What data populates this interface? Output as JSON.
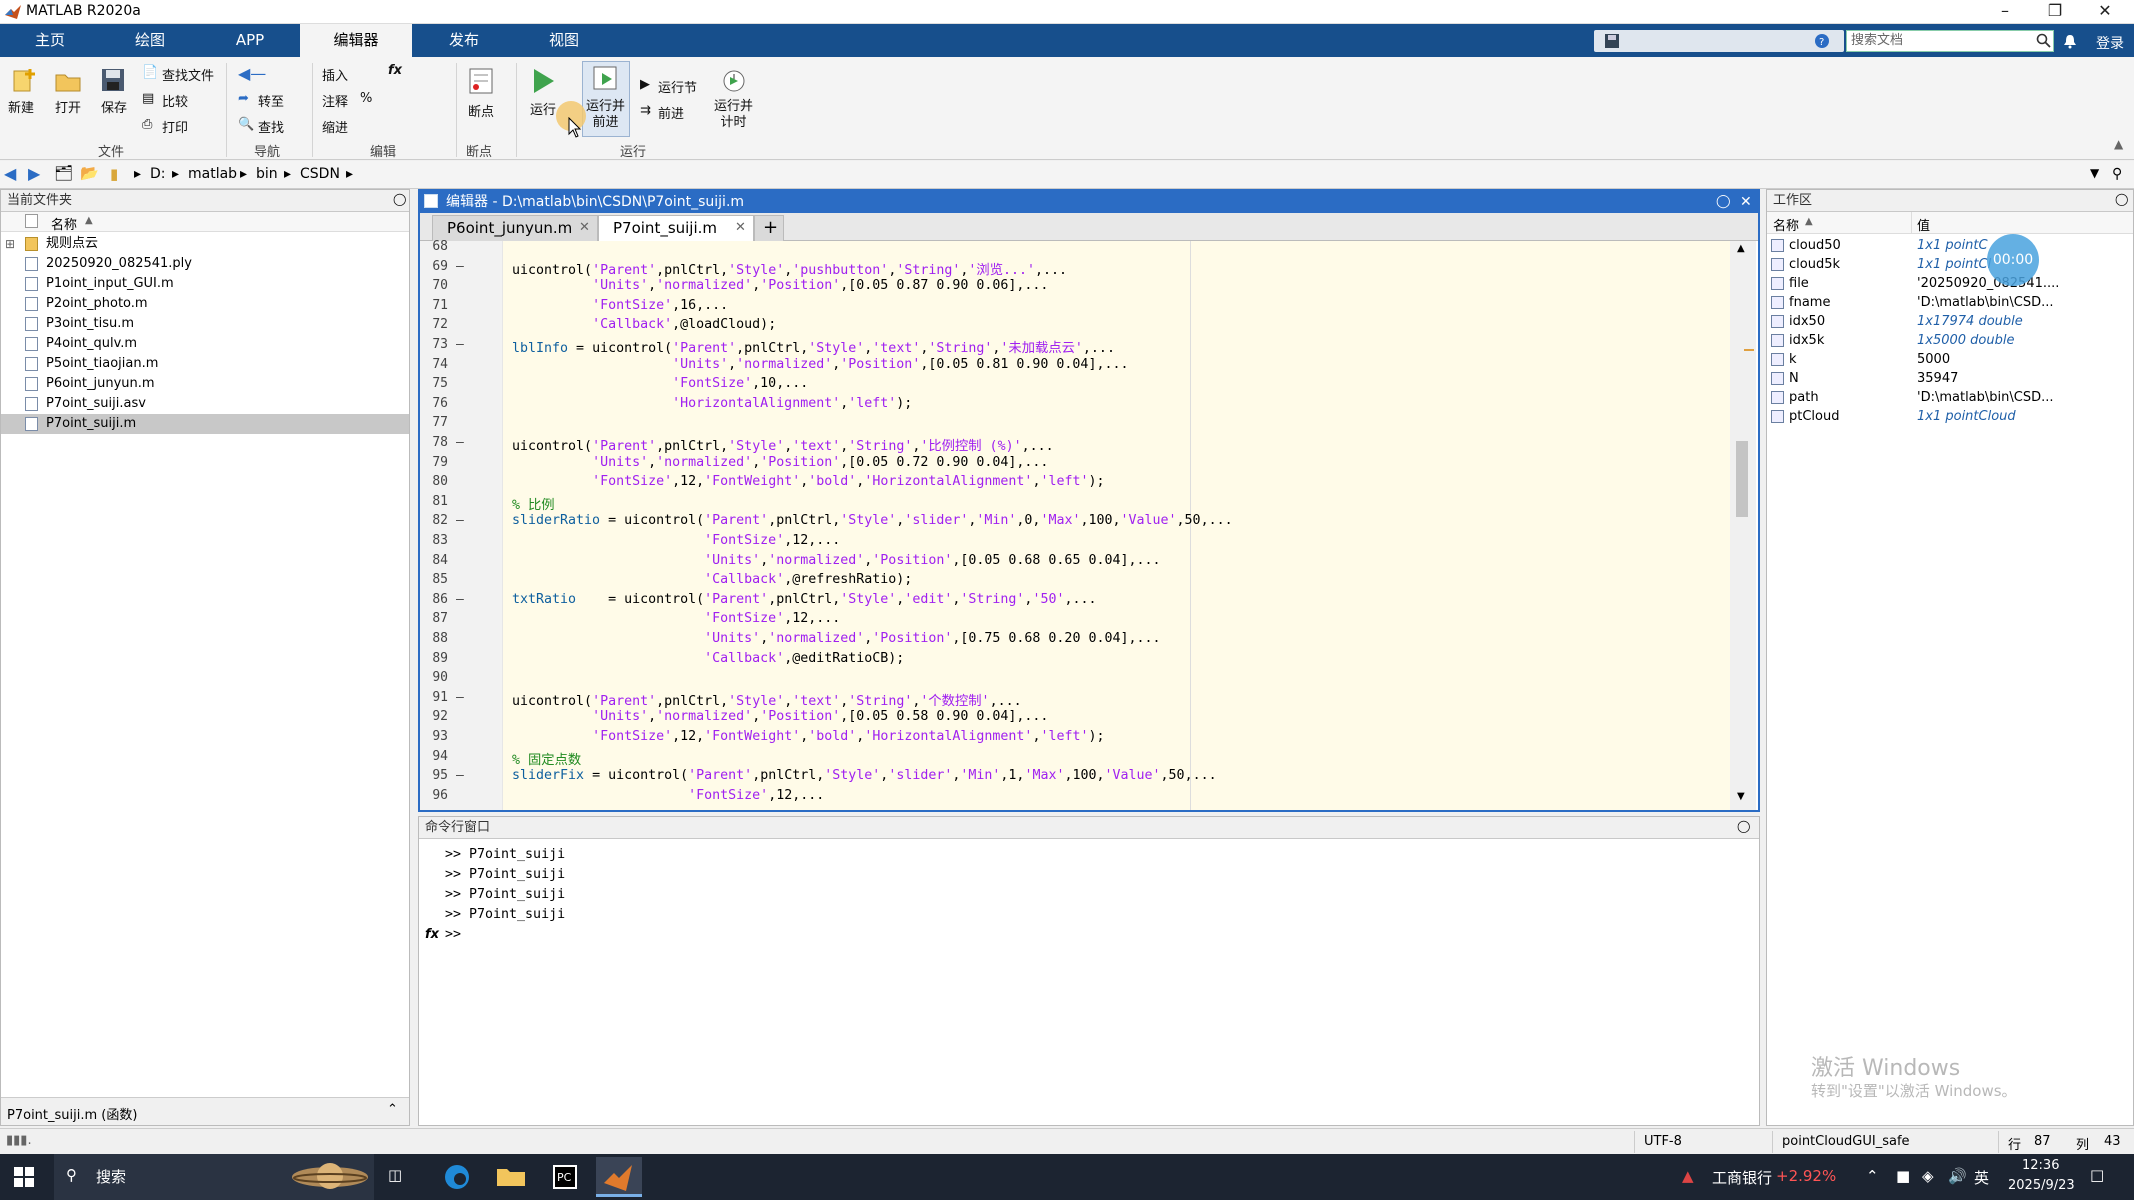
{
  "window": {
    "title": "MATLAB R2020a"
  },
  "ribbon_tabs": [
    {
      "label": "主页"
    },
    {
      "label": "绘图"
    },
    {
      "label": "APP"
    },
    {
      "label": "编辑器"
    },
    {
      "label": "发布"
    },
    {
      "label": "视图"
    }
  ],
  "active_tab": "编辑器",
  "search_doc_placeholder": "搜索文档",
  "login_label": "登录",
  "ribbon": {
    "file": {
      "new": "新建",
      "open": "打开",
      "save": "保存",
      "find_files": "查找文件",
      "compare": "比较",
      "print": "打印",
      "group": "文件"
    },
    "nav": {
      "goto": "转至",
      "find": "查找",
      "group": "导航"
    },
    "edit": {
      "insert": "插入",
      "comment": "注释",
      "indent": "缩进",
      "fx": "fx",
      "percent": "%",
      "group": "编辑"
    },
    "breakpoints": {
      "label": "断点",
      "group": "断点"
    },
    "run": {
      "run": "运行",
      "run_advance": "运行并\n前进",
      "run_section": "运行节",
      "advance": "前进",
      "run_time": "运行并\n计时",
      "group": "运行"
    }
  },
  "address": {
    "path": [
      "D:",
      "matlab",
      "bin",
      "CSDN"
    ]
  },
  "current_folder": {
    "title": "当前文件夹",
    "column": "名称",
    "items": [
      {
        "name": "规则点云",
        "type": "folder"
      },
      {
        "name": "20250920_082541.ply",
        "type": "file"
      },
      {
        "name": "P1oint_input_GUI.m",
        "type": "file"
      },
      {
        "name": "P2oint_photo.m",
        "type": "file"
      },
      {
        "name": "P3oint_tisu.m",
        "type": "file"
      },
      {
        "name": "P4oint_qulv.m",
        "type": "file"
      },
      {
        "name": "P5oint_tiaojian.m",
        "type": "file"
      },
      {
        "name": "P6oint_junyun.m",
        "type": "file"
      },
      {
        "name": "P7oint_suiji.asv",
        "type": "file"
      },
      {
        "name": "P7oint_suiji.m",
        "type": "file",
        "selected": true
      }
    ],
    "details": "P7oint_suiji.m  (函数)"
  },
  "editor": {
    "header": "编辑器 - D:\\matlab\\bin\\CSDN\\P7oint_suiji.m",
    "tabs": [
      {
        "label": "P6oint_junyun.m"
      },
      {
        "label": "P7oint_suiji.m",
        "active": true
      }
    ],
    "add_tab": "+",
    "lines": [
      {
        "n": "68",
        "d": "",
        "code": ""
      },
      {
        "n": "69",
        "d": "—",
        "code": "uicontrol('Parent',pnlCtrl,'Style','pushbutton','String','浏览...',..."
      },
      {
        "n": "70",
        "d": "",
        "code": "          'Units','normalized','Position',[0.05 0.87 0.90 0.06],..."
      },
      {
        "n": "71",
        "d": "",
        "code": "          'FontSize',16,..."
      },
      {
        "n": "72",
        "d": "",
        "code": "          'Callback',@loadCloud);"
      },
      {
        "n": "73",
        "d": "—",
        "code": "lblInfo = uicontrol('Parent',pnlCtrl,'Style','text','String','未加载点云',..."
      },
      {
        "n": "74",
        "d": "",
        "code": "                    'Units','normalized','Position',[0.05 0.81 0.90 0.04],..."
      },
      {
        "n": "75",
        "d": "",
        "code": "                    'FontSize',10,..."
      },
      {
        "n": "76",
        "d": "",
        "code": "                    'HorizontalAlignment','left');"
      },
      {
        "n": "77",
        "d": "",
        "code": ""
      },
      {
        "n": "78",
        "d": "—",
        "code": "uicontrol('Parent',pnlCtrl,'Style','text','String','比例控制 (%)',..."
      },
      {
        "n": "79",
        "d": "",
        "code": "          'Units','normalized','Position',[0.05 0.72 0.90 0.04],..."
      },
      {
        "n": "80",
        "d": "",
        "code": "          'FontSize',12,'FontWeight','bold','HorizontalAlignment','left');"
      },
      {
        "n": "81",
        "d": "",
        "code": "% 比例"
      },
      {
        "n": "82",
        "d": "—",
        "code": "sliderRatio = uicontrol('Parent',pnlCtrl,'Style','slider','Min',0,'Max',100,'Value',50,..."
      },
      {
        "n": "83",
        "d": "",
        "code": "                        'FontSize',12,..."
      },
      {
        "n": "84",
        "d": "",
        "code": "                        'Units','normalized','Position',[0.05 0.68 0.65 0.04],..."
      },
      {
        "n": "85",
        "d": "",
        "code": "                        'Callback',@refreshRatio);"
      },
      {
        "n": "86",
        "d": "—",
        "code": "txtRatio    = uicontrol('Parent',pnlCtrl,'Style','edit','String','50',..."
      },
      {
        "n": "87",
        "d": "",
        "code": "                        'FontSize',12,..."
      },
      {
        "n": "88",
        "d": "",
        "code": "                        'Units','normalized','Position',[0.75 0.68 0.20 0.04],..."
      },
      {
        "n": "89",
        "d": "",
        "code": "                        'Callback',@editRatioCB);"
      },
      {
        "n": "90",
        "d": "",
        "code": ""
      },
      {
        "n": "91",
        "d": "—",
        "code": "uicontrol('Parent',pnlCtrl,'Style','text','String','个数控制',..."
      },
      {
        "n": "92",
        "d": "",
        "code": "          'Units','normalized','Position',[0.05 0.58 0.90 0.04],..."
      },
      {
        "n": "93",
        "d": "",
        "code": "          'FontSize',12,'FontWeight','bold','HorizontalAlignment','left');"
      },
      {
        "n": "94",
        "d": "",
        "code": "% 固定点数"
      },
      {
        "n": "95",
        "d": "—",
        "code": "sliderFix = uicontrol('Parent',pnlCtrl,'Style','slider','Min',1,'Max',100,'Value',50,..."
      },
      {
        "n": "96",
        "d": "",
        "code": "                      'FontSize',12,..."
      }
    ]
  },
  "command_window": {
    "title": "命令行窗口",
    "lines": [
      ">> P7oint_suiji",
      ">> P7oint_suiji",
      ">> P7oint_suiji",
      ">> P7oint_suiji"
    ],
    "prompt": ">>",
    "fx": "fx"
  },
  "workspace": {
    "title": "工作区",
    "col_name": "名称",
    "col_value": "值",
    "vars": [
      {
        "name": "cloud50",
        "value": "1x1 pointC",
        "italic": true
      },
      {
        "name": "cloud5k",
        "value": "1x1 pointCl",
        "italic": true
      },
      {
        "name": "file",
        "value": "'20250920_082541....",
        "italic": false
      },
      {
        "name": "fname",
        "value": "'D:\\matlab\\bin\\CSD...",
        "italic": false
      },
      {
        "name": "idx50",
        "value": "1x17974 double",
        "italic": true
      },
      {
        "name": "idx5k",
        "value": "1x5000 double",
        "italic": true
      },
      {
        "name": "k",
        "value": "5000",
        "italic": false
      },
      {
        "name": "N",
        "value": "35947",
        "italic": false
      },
      {
        "name": "path",
        "value": "'D:\\matlab\\bin\\CSD...",
        "italic": false
      },
      {
        "name": "ptCloud",
        "value": "1x1 pointCloud",
        "italic": true
      }
    ],
    "timer": "00:00",
    "watermark1": "激活 Windows",
    "watermark2": "转到\"设置\"以激活 Windows。"
  },
  "status": {
    "encoding": "UTF-8",
    "function": "pointCloudGUI_safe",
    "row_label": "行",
    "row": "87",
    "col_label": "列",
    "col": "43"
  },
  "taskbar": {
    "search": "搜索",
    "stock": "工商银行",
    "stock_change": "+2.92%",
    "ime": "英",
    "time": "12:36",
    "date": "2025/9/23"
  },
  "colors": {
    "ribbon_blue": "#174f8c",
    "editor_blue": "#2b6cc4",
    "code_bg": "#fffbe8",
    "string": "#a020f0",
    "comment": "#228b22"
  }
}
